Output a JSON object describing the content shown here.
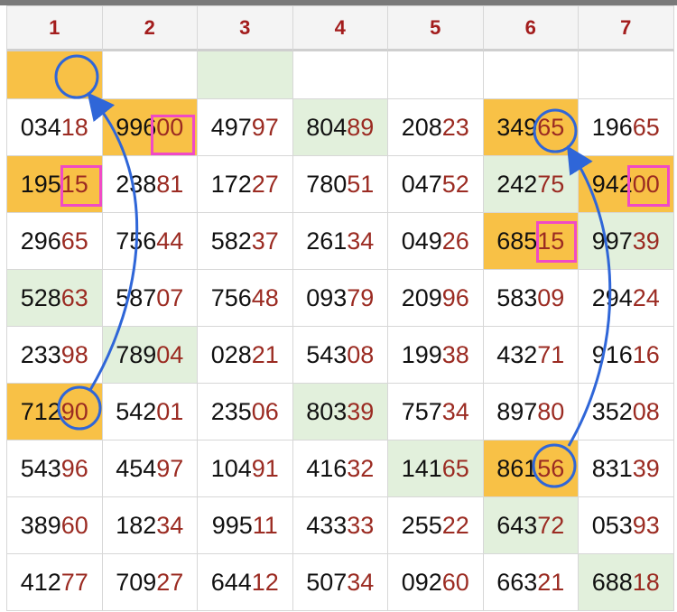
{
  "headers": [
    "1",
    "2",
    "3",
    "4",
    "5",
    "6",
    "7"
  ],
  "top_row_fills": [
    "orange",
    "",
    "green",
    "",
    "",
    "",
    ""
  ],
  "rows": [
    [
      {
        "pre": "034",
        "suf": "18",
        "bg": ""
      },
      {
        "pre": "996",
        "suf": "00",
        "bg": "orange"
      },
      {
        "pre": "497",
        "suf": "97",
        "bg": ""
      },
      {
        "pre": "804",
        "suf": "89",
        "bg": "green"
      },
      {
        "pre": "208",
        "suf": "23",
        "bg": ""
      },
      {
        "pre": "349",
        "suf": "65",
        "bg": "orange"
      },
      {
        "pre": "196",
        "suf": "65",
        "bg": ""
      }
    ],
    [
      {
        "pre": "195",
        "suf": "15",
        "bg": "orange"
      },
      {
        "pre": "238",
        "suf": "81",
        "bg": ""
      },
      {
        "pre": "172",
        "suf": "27",
        "bg": ""
      },
      {
        "pre": "780",
        "suf": "51",
        "bg": ""
      },
      {
        "pre": "047",
        "suf": "52",
        "bg": ""
      },
      {
        "pre": "242",
        "suf": "75",
        "bg": "green"
      },
      {
        "pre": "942",
        "suf": "00",
        "bg": "orange"
      }
    ],
    [
      {
        "pre": "296",
        "suf": "65",
        "bg": ""
      },
      {
        "pre": "756",
        "suf": "44",
        "bg": ""
      },
      {
        "pre": "582",
        "suf": "37",
        "bg": ""
      },
      {
        "pre": "261",
        "suf": "34",
        "bg": ""
      },
      {
        "pre": "049",
        "suf": "26",
        "bg": ""
      },
      {
        "pre": "685",
        "suf": "15",
        "bg": "orange"
      },
      {
        "pre": "997",
        "suf": "39",
        "bg": "green"
      }
    ],
    [
      {
        "pre": "528",
        "suf": "63",
        "bg": "green"
      },
      {
        "pre": "587",
        "suf": "07",
        "bg": ""
      },
      {
        "pre": "756",
        "suf": "48",
        "bg": ""
      },
      {
        "pre": "093",
        "suf": "79",
        "bg": ""
      },
      {
        "pre": "209",
        "suf": "96",
        "bg": ""
      },
      {
        "pre": "583",
        "suf": "09",
        "bg": ""
      },
      {
        "pre": "294",
        "suf": "24",
        "bg": ""
      }
    ],
    [
      {
        "pre": "233",
        "suf": "98",
        "bg": ""
      },
      {
        "pre": "789",
        "suf": "04",
        "bg": "green"
      },
      {
        "pre": "028",
        "suf": "21",
        "bg": ""
      },
      {
        "pre": "543",
        "suf": "08",
        "bg": ""
      },
      {
        "pre": "199",
        "suf": "38",
        "bg": ""
      },
      {
        "pre": "432",
        "suf": "71",
        "bg": ""
      },
      {
        "pre": "916",
        "suf": "16",
        "bg": ""
      }
    ],
    [
      {
        "pre": "712",
        "suf": "90",
        "bg": "orange"
      },
      {
        "pre": "542",
        "suf": "01",
        "bg": ""
      },
      {
        "pre": "235",
        "suf": "06",
        "bg": ""
      },
      {
        "pre": "803",
        "suf": "39",
        "bg": "green"
      },
      {
        "pre": "757",
        "suf": "34",
        "bg": ""
      },
      {
        "pre": "897",
        "suf": "80",
        "bg": ""
      },
      {
        "pre": "352",
        "suf": "08",
        "bg": ""
      }
    ],
    [
      {
        "pre": "543",
        "suf": "96",
        "bg": ""
      },
      {
        "pre": "454",
        "suf": "97",
        "bg": ""
      },
      {
        "pre": "104",
        "suf": "91",
        "bg": ""
      },
      {
        "pre": "416",
        "suf": "32",
        "bg": ""
      },
      {
        "pre": "141",
        "suf": "65",
        "bg": "green"
      },
      {
        "pre": "861",
        "suf": "56",
        "bg": "orange"
      },
      {
        "pre": "831",
        "suf": "39",
        "bg": ""
      }
    ],
    [
      {
        "pre": "389",
        "suf": "60",
        "bg": ""
      },
      {
        "pre": "182",
        "suf": "34",
        "bg": ""
      },
      {
        "pre": "995",
        "suf": "11",
        "bg": ""
      },
      {
        "pre": "433",
        "suf": "33",
        "bg": ""
      },
      {
        "pre": "255",
        "suf": "22",
        "bg": ""
      },
      {
        "pre": "643",
        "suf": "72",
        "bg": "green"
      },
      {
        "pre": "053",
        "suf": "93",
        "bg": ""
      }
    ],
    [
      {
        "pre": "412",
        "suf": "77",
        "bg": ""
      },
      {
        "pre": "709",
        "suf": "27",
        "bg": ""
      },
      {
        "pre": "644",
        "suf": "12",
        "bg": ""
      },
      {
        "pre": "507",
        "suf": "34",
        "bg": ""
      },
      {
        "pre": "092",
        "suf": "60",
        "bg": ""
      },
      {
        "pre": "663",
        "suf": "21",
        "bg": ""
      },
      {
        "pre": "688",
        "suf": "18",
        "bg": "green"
      }
    ]
  ],
  "colors": {
    "orange": "#f8c146",
    "green": "#e2f0dc",
    "suffix": "#9b2b22",
    "header": "#a31d1d",
    "pink_box": "#f04ac6",
    "blue_annotation": "#2f66d8"
  },
  "icons": {
    "circle": "circle-highlight-icon",
    "arrow": "curved-arrow-icon"
  }
}
